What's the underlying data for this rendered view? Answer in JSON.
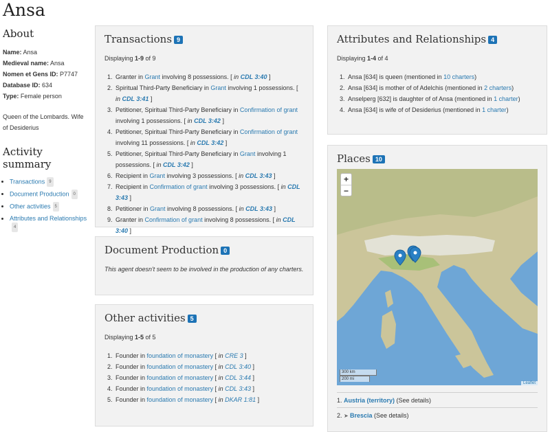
{
  "page": {
    "title": "Ansa"
  },
  "about": {
    "heading": "About",
    "fields": [
      {
        "label": "Name:",
        "value": "Ansa"
      },
      {
        "label": "Medieval name:",
        "value": "Ansa"
      },
      {
        "label": "Nomen et Gens ID:",
        "value": "P7747"
      },
      {
        "label": "Database ID:",
        "value": "634"
      },
      {
        "label": "Type:",
        "value": "Female person"
      }
    ],
    "description": "Queen of the Lombards. Wife of Desiderius"
  },
  "activity_summary": {
    "heading": "Activity summary",
    "items": [
      {
        "label": "Transactions",
        "count": "9"
      },
      {
        "label": "Document Production",
        "count": "0"
      },
      {
        "label": "Other activities",
        "count": "5"
      },
      {
        "label": "Attributes and Relationships",
        "count": "4"
      }
    ]
  },
  "transactions": {
    "title": "Transactions",
    "count": "9",
    "displaying_prefix": "Displaying ",
    "displaying_range": "1-9",
    "displaying_suffix": " of 9",
    "items": [
      {
        "pre": "Granter in ",
        "link": "Grant",
        "post": " involving 8 possessions. [ ",
        "cite_in": "in ",
        "ref": "CDL 3:40",
        "close": " ]"
      },
      {
        "pre": "Spiritual Third-Party Beneficiary in ",
        "link": "Grant",
        "post": " involving 1 possessions. [ ",
        "cite_in": "in ",
        "ref": "CDL 3:41",
        "close": " ]"
      },
      {
        "pre": "Petitioner, Spiritual Third-Party Beneficiary in ",
        "link": "Confirmation of grant",
        "post": " involving 1 possessions. [ ",
        "cite_in": "in ",
        "ref": "CDL 3:42",
        "close": " ]"
      },
      {
        "pre": "Petitioner, Spiritual Third-Party Beneficiary in ",
        "link": "Confirmation of grant",
        "post": " involving 11 possessions. [ ",
        "cite_in": "in ",
        "ref": "CDL 3:42",
        "close": " ]"
      },
      {
        "pre": "Petitioner, Spiritual Third-Party Beneficiary in ",
        "link": "Grant",
        "post": " involving 1 possessions. [ ",
        "cite_in": "in ",
        "ref": "CDL 3:42",
        "close": " ]"
      },
      {
        "pre": "Recipient in ",
        "link": "Grant",
        "post": " involving 3 possessions. [ ",
        "cite_in": "in ",
        "ref": "CDL 3:43",
        "close": " ]"
      },
      {
        "pre": "Recipient in ",
        "link": "Confirmation of grant",
        "post": " involving 3 possessions. [ ",
        "cite_in": "in ",
        "ref": "CDL 3:43",
        "close": " ]"
      },
      {
        "pre": "Petitioner in ",
        "link": "Grant",
        "post": " involving 8 possessions. [ ",
        "cite_in": "in ",
        "ref": "CDL 3:43",
        "close": " ]"
      },
      {
        "pre": "Granter in ",
        "link": "Confirmation of grant",
        "post": " involving 8 possessions. [ ",
        "cite_in": "in ",
        "ref": "CDL 3:40",
        "close": " ]"
      }
    ]
  },
  "document_production": {
    "title": "Document Production",
    "count": "0",
    "note": "This agent doesn't seem to be involved in the production of any charters."
  },
  "other_activities": {
    "title": "Other activities",
    "count": "5",
    "displaying_prefix": "Displaying ",
    "displaying_range": "1-5",
    "displaying_suffix": " of 5",
    "items": [
      {
        "pre": "Founder in ",
        "link": "foundation of monastery",
        "post": " [ ",
        "cite_in": "in ",
        "ref": "CRE 3",
        "close": " ]"
      },
      {
        "pre": "Founder in ",
        "link": "foundation of monastery",
        "post": " [ ",
        "cite_in": "in ",
        "ref": "CDL 3:40",
        "close": " ]"
      },
      {
        "pre": "Founder in ",
        "link": "foundation of monastery",
        "post": " [ ",
        "cite_in": "in ",
        "ref": "CDL 3:44",
        "close": " ]"
      },
      {
        "pre": "Founder in ",
        "link": "foundation of monastery",
        "post": " [ ",
        "cite_in": "in ",
        "ref": "CDL 3:43",
        "close": " ]"
      },
      {
        "pre": "Founder in ",
        "link": "foundation of monastery",
        "post": " [ ",
        "cite_in": "in ",
        "ref": "DKAR 1:81",
        "close": " ]"
      }
    ]
  },
  "attributes": {
    "title": "Attributes and Relationships",
    "count": "4",
    "displaying_prefix": "Displaying ",
    "displaying_range": "1-4",
    "displaying_suffix": " of 4",
    "items": [
      {
        "pre": "Ansa [634] is queen (mentioned in ",
        "link": "10 charters",
        "post": ")"
      },
      {
        "pre": "Ansa [634] is mother of of Adelchis (mentioned in ",
        "link": "2 charters",
        "post": ")"
      },
      {
        "pre": "Anselperg [632] is daughter of of Ansa (mentioned in ",
        "link": "1 charter",
        "post": ")"
      },
      {
        "pre": "Ansa [634] is wife of of Desiderius (mentioned in ",
        "link": "1 charter",
        "post": ")"
      }
    ]
  },
  "places": {
    "title": "Places",
    "count": "10",
    "map": {
      "zoom_in": "+",
      "zoom_out": "−",
      "scale_km": "300 km",
      "scale_mi": "200 mi",
      "attribution": "Leaflet"
    },
    "items": [
      {
        "num": "1.",
        "name": "Austria (territory)",
        "details": " (See details)"
      },
      {
        "num": "2.",
        "name": "Brescia",
        "details": " (See details)"
      }
    ]
  },
  "colors": {
    "accent": "#1d73b6",
    "link": "#2a7ab0",
    "panel_bg": "#f2f2f2",
    "sea": "#6ea6d6",
    "land": "#c9c39a"
  }
}
